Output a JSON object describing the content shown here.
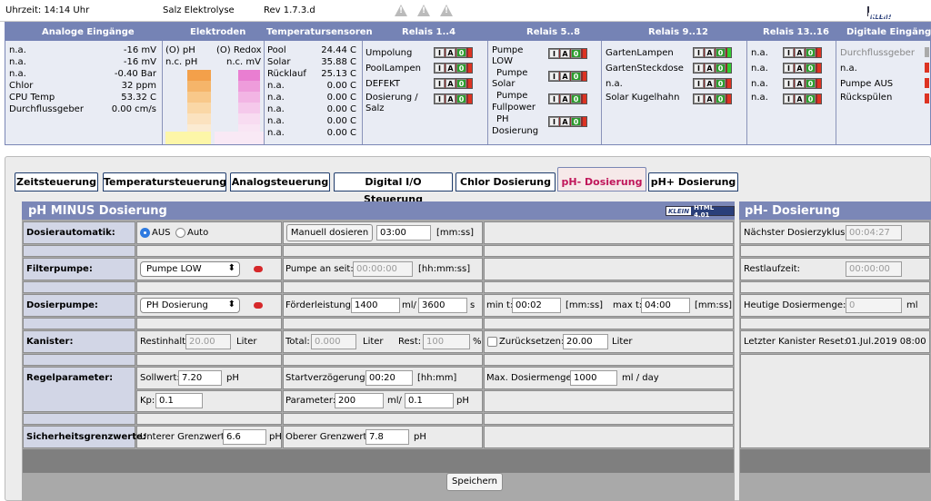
{
  "topbar": {
    "time": "Uhrzeit: 14:14 Uhr",
    "device": "Salz Elektrolyse",
    "version": "Rev 1.7.3.d",
    "logo_k": "KLEIN",
    "logo_html": "HTML 4.01",
    "icons": [
      "warning-icon",
      "warning-icon",
      "warning-icon"
    ]
  },
  "header": {
    "analog": {
      "title": "Analoge Eingänge",
      "rows": [
        {
          "label": "n.a.",
          "value": "-16 mV"
        },
        {
          "label": "n.a.",
          "value": "-16 mV"
        },
        {
          "label": "n.a.",
          "value": "-0.40 Bar"
        },
        {
          "label": "Chlor",
          "value": "32 ppm"
        },
        {
          "label": "CPU Temp",
          "value": "53.32 C"
        },
        {
          "label": "Durchflussgeber",
          "value": "0.00 cm/s"
        }
      ]
    },
    "electrodes": {
      "title": "Elektroden",
      "ph_label": "(O) pH",
      "ph_value": "n.c. pH",
      "redox_label": "(O) Redox",
      "redox_value": "n.c. mV"
    },
    "temp": {
      "title": "Temperatursensoren",
      "rows": [
        {
          "label": "Pool",
          "value": "24.44 C"
        },
        {
          "label": "Solar",
          "value": "35.88 C"
        },
        {
          "label": "Rücklauf",
          "value": "25.13 C"
        },
        {
          "label": "n.a.",
          "value": "0.00 C"
        },
        {
          "label": "n.a.",
          "value": "0.00 C"
        },
        {
          "label": "n.a.",
          "value": "0.00 C"
        },
        {
          "label": "n.a.",
          "value": "0.00 C"
        },
        {
          "label": "n.a.",
          "value": "0.00 C"
        }
      ]
    },
    "relais14": {
      "title": "Relais 1..4",
      "rows": [
        "Umpolung",
        "PoolLampen",
        "DEFEKT",
        "Dosierung /",
        "Salz"
      ]
    },
    "relais58": {
      "title": "Relais 5..8",
      "lines": [
        "Pumpe",
        "LOW",
        "Pumpe",
        "Solar",
        "Pumpe",
        "Fullpower",
        "PH",
        "Dosierung"
      ]
    },
    "relais912": {
      "title": "Relais 9..12",
      "rows": [
        "GartenLampen",
        "GartenSteckdose",
        "n.a.",
        "Solar Kugelhahn"
      ]
    },
    "relais1316": {
      "title": "Relais 13..16",
      "rows": [
        "n.a.",
        "n.a.",
        "n.a.",
        "n.a."
      ]
    },
    "digital": {
      "title": "Digitale Eingänge",
      "rows": [
        "Durchflussgeber",
        "n.a.",
        "Pumpe AUS",
        "Rückspülen"
      ]
    },
    "ia0": [
      "I",
      "A",
      "0"
    ]
  },
  "tabs": [
    "Zeitsteuerung",
    "Temperatursteuerung",
    "Analogsteuerung",
    "Digital I/O Steuerung",
    "Chlor Dosierung",
    "pH- Dosierung",
    "pH+ Dosierung"
  ],
  "form": {
    "title": "pH MINUS Dosierung",
    "dosierautomatik": {
      "label": "Dosierautomatik:",
      "opt_aus": "AUS",
      "opt_auto": "Auto",
      "button": "Manuell dosieren",
      "time": "03:00",
      "unit": "[mm:ss]"
    },
    "filterpumpe": {
      "label": "Filterpumpe:",
      "select": "Pumpe LOW",
      "seit_label": "Pumpe an seit:",
      "seit_value": "00:00:00",
      "unit": "[hh:mm:ss]"
    },
    "dosierpumpe": {
      "label": "Dosierpumpe:",
      "select": "PH Dosierung",
      "foerder_label": "Förderleistung:",
      "ml": "1400",
      "ml_unit": "ml/",
      "s": "3600",
      "s_unit": "s",
      "mint_label": "min t:",
      "mint": "00:02",
      "mint_unit": "[mm:ss]",
      "maxt_label": "max t:",
      "maxt": "04:00",
      "maxt_unit": "[mm:ss]"
    },
    "kanister": {
      "label": "Kanister:",
      "rest_label": "Restinhalt:",
      "rest": "20.00",
      "rest_unit": "Liter",
      "total_label": "Total:",
      "total": "0.000",
      "total_unit": "Liter",
      "restp_label": "Rest:",
      "restp": "100",
      "restp_unit": "%",
      "reset_label": "Zurücksetzen:",
      "reset": "20.00",
      "reset_unit": "Liter"
    },
    "regel": {
      "label": "Regelparameter:",
      "soll_label": "Sollwert:",
      "soll": "7.20",
      "soll_unit": "pH",
      "start_label": "Startverzögerung:",
      "start": "00:20",
      "start_unit": "[hh:mm]",
      "maxd_label": "Max. Dosiermenge:",
      "maxd": "1000",
      "maxd_unit": "ml / day",
      "kp_label": "Kp:",
      "kp": "0.1",
      "param_label": "Parameter:",
      "param1": "200",
      "param_mid": "ml/",
      "param2": "0.1",
      "param_unit": "pH"
    },
    "sicher": {
      "label": "Sicherheitsgrenzwerte:",
      "unten_label": "Unterer Grenzwert:",
      "unten": "6.6",
      "unten_unit": "pH",
      "oben_label": "Oberer Grenzwert:",
      "oben": "7.8",
      "oben_unit": "pH"
    },
    "save": "Speichern"
  },
  "status": {
    "title": "pH- Dosierung",
    "next_label": "Nächster Dosierzyklus:",
    "next": "00:04:27",
    "restlauf_label": "Restlaufzeit:",
    "restlauf": "00:00:00",
    "heute_label": "Heutige Dosiermenge:",
    "heute": "0",
    "heute_unit": "ml",
    "lastreset_label": "Letzter Kanister Reset:",
    "lastreset": "01.Jul.2019 08:00"
  }
}
